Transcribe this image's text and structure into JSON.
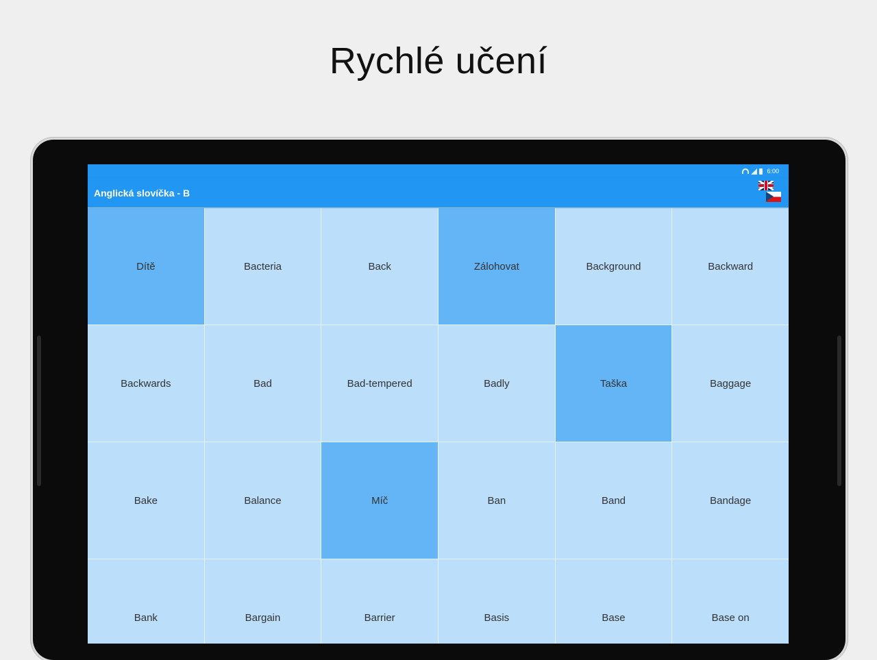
{
  "headline": "Rychlé učení",
  "status": {
    "time": "6:00"
  },
  "appbar": {
    "title": "Anglická slovíčka - B",
    "lang_toggle_icon": "uk-cz-flag-icon"
  },
  "colors": {
    "primary": "#2196f3",
    "tile": "#bbdefb",
    "tile_selected": "#64b5f6",
    "background": "#efefef"
  },
  "tiles": [
    {
      "label": "Dítě",
      "selected": true
    },
    {
      "label": "Bacteria",
      "selected": false
    },
    {
      "label": "Back",
      "selected": false
    },
    {
      "label": "Zálohovat",
      "selected": true
    },
    {
      "label": "Background",
      "selected": false
    },
    {
      "label": "Backward",
      "selected": false
    },
    {
      "label": "Backwards",
      "selected": false
    },
    {
      "label": "Bad",
      "selected": false
    },
    {
      "label": "Bad-tempered",
      "selected": false
    },
    {
      "label": "Badly",
      "selected": false
    },
    {
      "label": "Taška",
      "selected": true
    },
    {
      "label": "Baggage",
      "selected": false
    },
    {
      "label": "Bake",
      "selected": false
    },
    {
      "label": "Balance",
      "selected": false
    },
    {
      "label": "Míč",
      "selected": true
    },
    {
      "label": "Ban",
      "selected": false
    },
    {
      "label": "Band",
      "selected": false
    },
    {
      "label": "Bandage",
      "selected": false
    },
    {
      "label": "Bank",
      "selected": false
    },
    {
      "label": "Bargain",
      "selected": false
    },
    {
      "label": "Barrier",
      "selected": false
    },
    {
      "label": "Basis",
      "selected": false
    },
    {
      "label": "Base",
      "selected": false
    },
    {
      "label": "Base on",
      "selected": false
    }
  ]
}
